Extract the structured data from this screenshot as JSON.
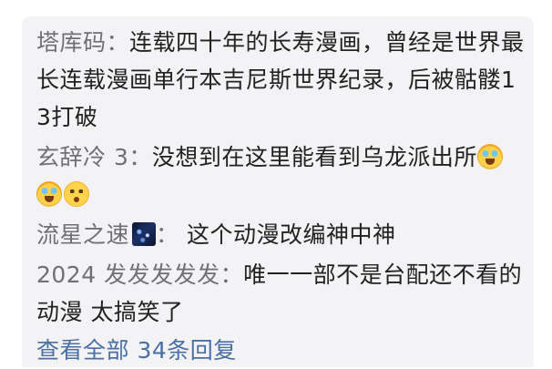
{
  "comments": [
    {
      "author": "塔库码",
      "colon": "：",
      "text": "连载四十年的长寿漫画，曾经是世界最长连载漫画单行本吉尼斯世界纪录，后被骷髅13打破"
    },
    {
      "author": "玄辞冷 3",
      "colon": "：",
      "text": "没想到在这里能看到乌龙派出所",
      "emojis": [
        "crying-laughing-emoji",
        "crying-laughing-emoji",
        "sad-emoji"
      ]
    },
    {
      "author": "流星之速",
      "author_badge": "starry-avatar-image",
      "colon": "：",
      "text": " 这个动漫改编神中神"
    },
    {
      "author": "2024 发发发发发",
      "colon": "：",
      "text": "唯一一部不是台配还不看的动漫 太搞笑了"
    }
  ],
  "view_all_replies": "查看全部 34条回复",
  "colors": {
    "card_background": "#f3f3f5",
    "author": "#6f6f75",
    "text": "#222222",
    "link": "#4a6fa5"
  }
}
